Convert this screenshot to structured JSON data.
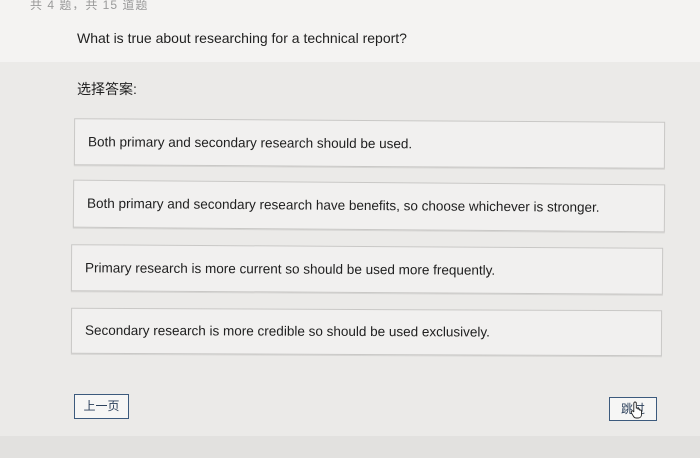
{
  "header": {
    "partial_text": "共 4 题，共 15 道题"
  },
  "question": {
    "text": "What is true about researching for a technical report?"
  },
  "choose_label": "选择答案:",
  "options": [
    {
      "label": "Both primary and secondary research should be used."
    },
    {
      "label": "Both primary and secondary research have benefits, so choose whichever is stronger."
    },
    {
      "label": "Primary research is more current so should be used more frequently."
    },
    {
      "label": "Secondary research is more credible so should be used exclusively."
    }
  ],
  "buttons": {
    "prev_label": "上一页",
    "skip_label": "跳过"
  },
  "colors": {
    "button_border": "#3c5a7d",
    "page_background": "#ebeae8"
  }
}
